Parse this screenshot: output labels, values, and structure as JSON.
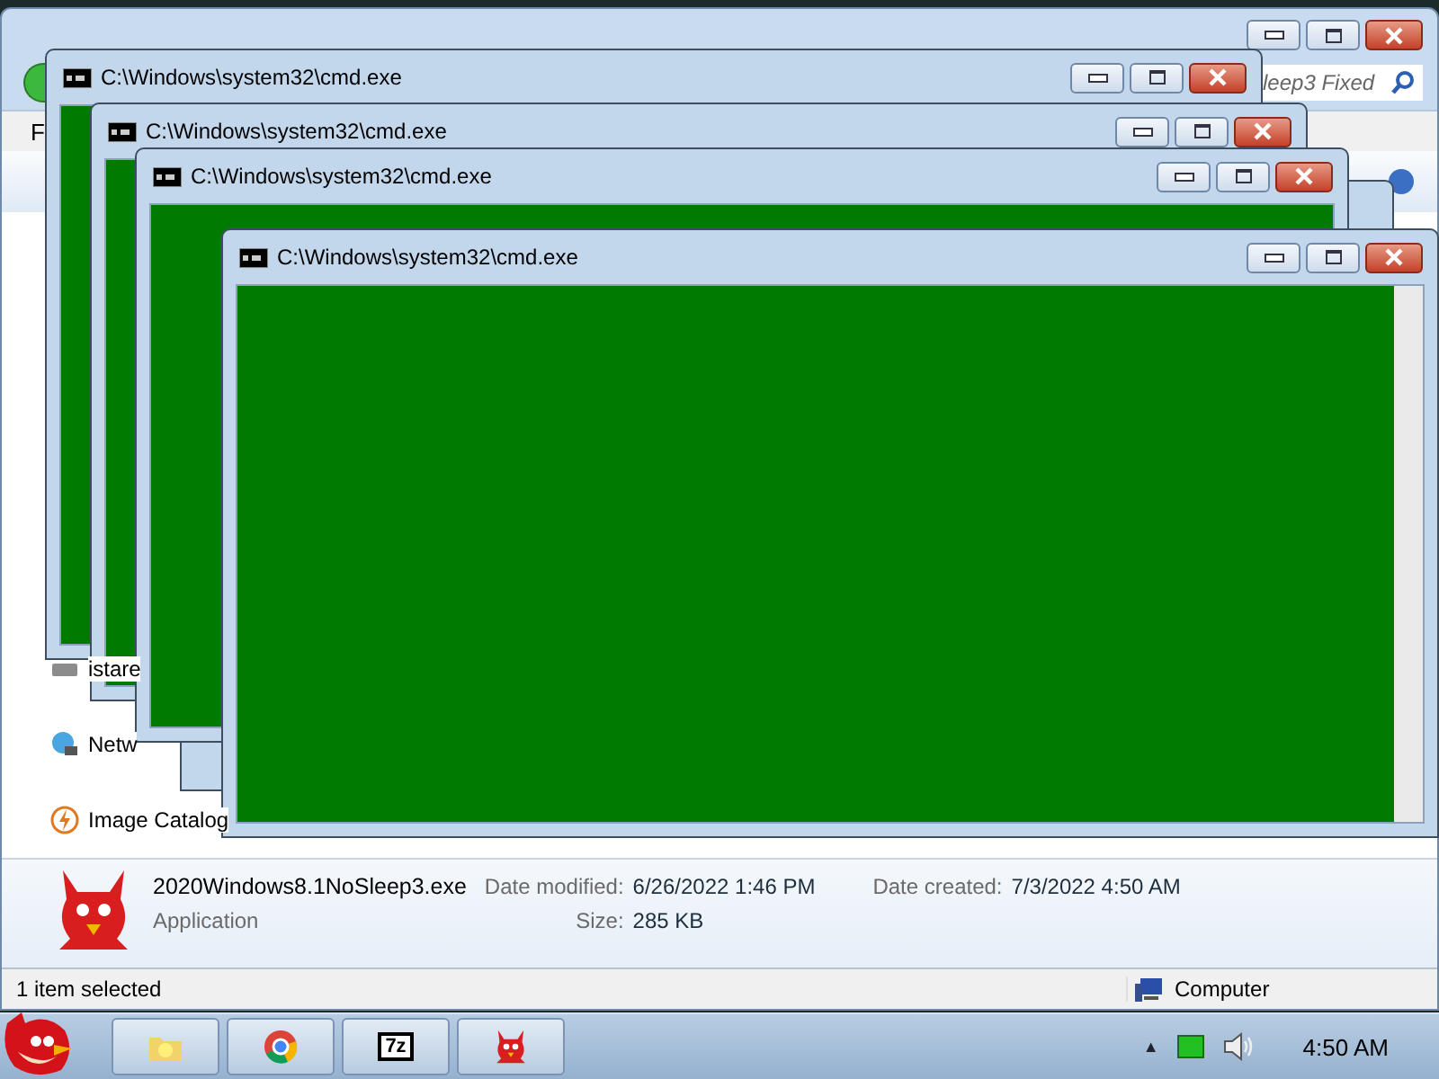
{
  "explorer": {
    "search": {
      "placeholder": "leep3 Fixed"
    },
    "menu": [
      "F"
    ],
    "nav_items": [
      {
        "label": "istare",
        "kind": "drive"
      },
      {
        "label": "Netw",
        "kind": "network"
      },
      {
        "label": "Image Catalog",
        "kind": "catalog"
      }
    ],
    "details": {
      "file_name": "2020Windows8.1NoSleep3.exe",
      "file_type": "Application",
      "modified_label": "Date modified:",
      "modified": "6/26/2022 1:46 PM",
      "size_label": "Size:",
      "size": "285 KB",
      "created_label": "Date created:",
      "created": "7/3/2022 4:50 AM"
    },
    "status_bar": {
      "text": "1 item selected",
      "location": "Computer"
    }
  },
  "cmd_windows": [
    {
      "title": "C:\\Windows\\system32\\cmd.exe"
    },
    {
      "title": "C:\\Windows\\system32\\cmd.exe"
    },
    {
      "title": "C:\\Windows\\system32\\cmd.exe"
    },
    {
      "title": "C:\\Windows\\system32\\cmd.exe"
    }
  ],
  "taskbar": {
    "items": [
      {
        "kind": "folder"
      },
      {
        "kind": "browser"
      },
      {
        "kind": "archiver",
        "label": "7z"
      },
      {
        "kind": "devil"
      }
    ],
    "tray_arrow": "▲",
    "time": "4:50 AM"
  }
}
